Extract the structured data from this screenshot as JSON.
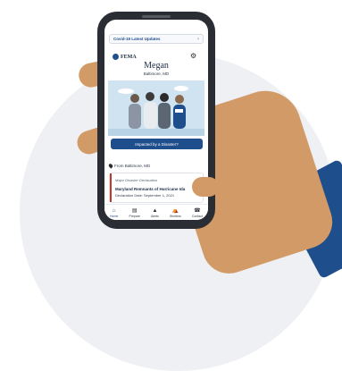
{
  "banner": {
    "covid_label": "Covid-19 Latest Updates"
  },
  "header": {
    "agency": "FEMA"
  },
  "profile": {
    "name": "Megan",
    "location": "Baltimore, MD"
  },
  "actions": {
    "impact_button": "Impacted by a Disaster?"
  },
  "location_row": {
    "label": "From Baltimore, MD"
  },
  "disaster_card": {
    "type": "Major Disaster Declaration",
    "title": "Maryland Remnants of Hurricane Ida",
    "date": "Declaration Date: September 1, 2021"
  },
  "nav": {
    "items": [
      {
        "label": "Home",
        "icon": "home-icon"
      },
      {
        "label": "Prepare",
        "icon": "prepare-icon"
      },
      {
        "label": "Alerts",
        "icon": "alerts-icon"
      },
      {
        "label": "Shelters",
        "icon": "shelters-icon"
      },
      {
        "label": "Contact",
        "icon": "contact-icon"
      }
    ]
  },
  "colors": {
    "brand": "#1f4e8c",
    "accent": "#c0392b",
    "phone": "#2b2d34",
    "skin": "#d29a66"
  }
}
